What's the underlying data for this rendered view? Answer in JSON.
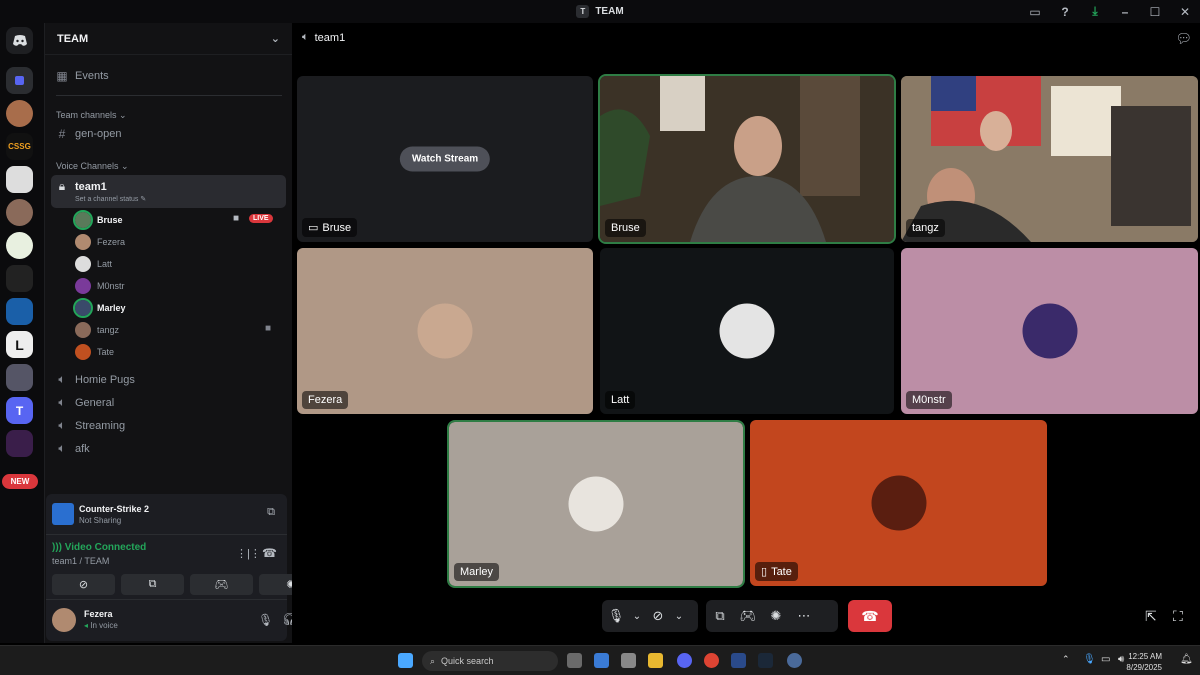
{
  "window": {
    "title": "TEAM",
    "app_icon_letter": "T"
  },
  "guild": {
    "name": "TEAM"
  },
  "sidebar": {
    "events_label": "Events",
    "team_category": "Team channels",
    "text_channel": "gen-open",
    "voice_category": "Voice Channels",
    "active_channel": {
      "name": "team1",
      "status": "Set a channel status"
    },
    "voice_users": [
      {
        "name": "Bruse",
        "bold": true,
        "live": "LIVE"
      },
      {
        "name": "Fezera",
        "bold": false
      },
      {
        "name": "Latt",
        "bold": false
      },
      {
        "name": "M0nstr",
        "bold": false
      },
      {
        "name": "Marley",
        "bold": true
      },
      {
        "name": "tangz",
        "bold": false
      },
      {
        "name": "Tate",
        "bold": false
      }
    ],
    "other_voice_channels": [
      "Homie Pugs",
      "General",
      "Streaming",
      "afk"
    ]
  },
  "rail": {
    "new_badge": "NEW",
    "t_server_letter": "T"
  },
  "game_panel": {
    "title": "Counter-Strike 2",
    "subtitle": "Not Sharing"
  },
  "voice_panel": {
    "status": "Video Connected",
    "location": "team1 / TEAM"
  },
  "user_panel": {
    "name": "Fezera",
    "status": "In voice"
  },
  "main": {
    "channel": "team1",
    "watch_stream": "Watch Stream",
    "tiles": [
      {
        "name": "Bruse"
      },
      {
        "name": "Bruse"
      },
      {
        "name": "tangz"
      },
      {
        "name": "Fezera"
      },
      {
        "name": "Latt"
      },
      {
        "name": "M0nstr"
      },
      {
        "name": "Marley"
      },
      {
        "name": "Tate"
      }
    ]
  },
  "taskbar": {
    "search_placeholder": "Quick search",
    "time": "12:25 AM",
    "date": "8/29/2025"
  },
  "colors": {
    "accent_green": "#2f7d45",
    "live_red": "#da373c",
    "blurple": "#5865f2"
  }
}
